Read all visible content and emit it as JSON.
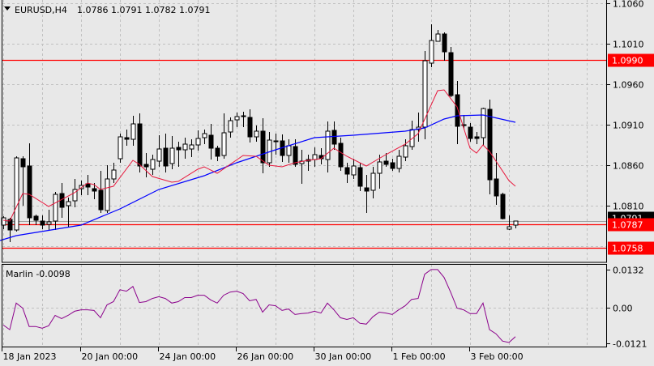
{
  "header": {
    "symbol": "EURUSD,H4",
    "ohlc": "1.0786 1.0791 1.0782 1.0791",
    "menu_icon": "triangle-down-icon"
  },
  "indicator": {
    "label": "Marlin -0.0098",
    "color": "#8b008b"
  },
  "price_tags": [
    {
      "text": "1.0990",
      "value": 1.099,
      "bg": "#ff0000",
      "line": true
    },
    {
      "text": "1.0791",
      "value": 1.0791,
      "bg": "#000000",
      "line": false
    },
    {
      "text": "1.0787",
      "value": 1.0787,
      "bg": "#ff0000",
      "line": true
    },
    {
      "text": "1.0758",
      "value": 1.0758,
      "bg": "#ff0000",
      "line": true
    }
  ],
  "colors": {
    "bull": "#ffffff",
    "bear": "#000000",
    "ma_fast": "#e8173c",
    "ma_slow": "#0000ff",
    "grid": "#c0c0c0",
    "level": "#ff0000",
    "bid": "#a0a0a0"
  },
  "chart_data": [
    {
      "type": "candlestick",
      "title": "EURUSD,H4",
      "ylim": [
        1.074,
        1.1064
      ],
      "yticks": [
        "1.1060",
        "1.1010",
        "1.0960",
        "1.0910",
        "1.0860",
        "1.0810"
      ],
      "xticks": [
        {
          "label": "18 Jan 2023",
          "bar": 0
        },
        {
          "label": "20 Jan 00:00",
          "bar": 12
        },
        {
          "label": "24 Jan 00:00",
          "bar": 24
        },
        {
          "label": "26 Jan 00:00",
          "bar": 36
        },
        {
          "label": "30 Jan 00:00",
          "bar": 48
        },
        {
          "label": "1 Feb 00:00",
          "bar": 60
        },
        {
          "label": "3 Feb 00:00",
          "bar": 72
        }
      ],
      "grid": true,
      "ohlc": [
        [
          1.0786,
          1.0797,
          1.0781,
          1.0795
        ],
        [
          1.0793,
          1.0795,
          1.0765,
          1.078
        ],
        [
          1.078,
          1.0871,
          1.0778,
          1.0869
        ],
        [
          1.0868,
          1.0871,
          1.081,
          1.0858
        ],
        [
          1.0859,
          1.0887,
          1.0786,
          1.0795
        ],
        [
          1.0797,
          1.0799,
          1.0786,
          1.0792
        ],
        [
          1.0791,
          1.0798,
          1.0781,
          1.0786
        ],
        [
          1.0787,
          1.0805,
          1.078,
          1.079
        ],
        [
          1.0791,
          1.0827,
          1.078,
          1.0824
        ],
        [
          1.0825,
          1.0838,
          1.0795,
          1.0808
        ],
        [
          1.081,
          1.082,
          1.0783,
          1.0815
        ],
        [
          1.0816,
          1.0843,
          1.0808,
          1.083
        ],
        [
          1.0831,
          1.0841,
          1.0823,
          1.0835
        ],
        [
          1.0837,
          1.0848,
          1.0823,
          1.0833
        ],
        [
          1.0831,
          1.0838,
          1.0818,
          1.0828
        ],
        [
          1.0829,
          1.0853,
          1.0801,
          1.0805
        ],
        [
          1.0804,
          1.086,
          1.0801,
          1.0843
        ],
        [
          1.0843,
          1.0863,
          1.0838,
          1.0854
        ],
        [
          1.0868,
          1.0899,
          1.0863,
          1.0895
        ],
        [
          1.0894,
          1.0904,
          1.0884,
          1.0892
        ],
        [
          1.0892,
          1.0921,
          1.0884,
          1.0911
        ],
        [
          1.0911,
          1.0924,
          1.0851,
          1.0859
        ],
        [
          1.0861,
          1.0875,
          1.0845,
          1.0858
        ],
        [
          1.0855,
          1.0873,
          1.0848,
          1.0867
        ],
        [
          1.0865,
          1.0897,
          1.0858,
          1.088
        ],
        [
          1.0881,
          1.0899,
          1.0851,
          1.0859
        ],
        [
          1.0862,
          1.0896,
          1.0855,
          1.0881
        ],
        [
          1.0882,
          1.0889,
          1.0858,
          1.0879
        ],
        [
          1.0879,
          1.0894,
          1.0868,
          1.0886
        ],
        [
          1.088,
          1.0892,
          1.087,
          1.0885
        ],
        [
          1.0885,
          1.0903,
          1.0878,
          1.0893
        ],
        [
          1.0894,
          1.0904,
          1.0886,
          1.0899
        ],
        [
          1.0897,
          1.0911,
          1.0867,
          1.0881
        ],
        [
          1.0881,
          1.0884,
          1.0865,
          1.0871
        ],
        [
          1.0872,
          1.0924,
          1.0868,
          1.09
        ],
        [
          1.0901,
          1.0919,
          1.0894,
          1.0915
        ],
        [
          1.0916,
          1.0925,
          1.0907,
          1.092
        ],
        [
          1.0921,
          1.0926,
          1.0907,
          1.092
        ],
        [
          1.0919,
          1.0929,
          1.0888,
          1.0895
        ],
        [
          1.0895,
          1.0909,
          1.0889,
          1.0902
        ],
        [
          1.0902,
          1.0918,
          1.085,
          1.0863
        ],
        [
          1.0863,
          1.0901,
          1.0858,
          1.0891
        ],
        [
          1.089,
          1.0899,
          1.0873,
          1.0889
        ],
        [
          1.089,
          1.0898,
          1.0864,
          1.0872
        ],
        [
          1.0872,
          1.0892,
          1.0863,
          1.0884
        ],
        [
          1.0883,
          1.0892,
          1.0858,
          1.0861
        ],
        [
          1.0862,
          1.0879,
          1.0837,
          1.0865
        ],
        [
          1.0865,
          1.0873,
          1.0853,
          1.0867
        ],
        [
          1.0867,
          1.0882,
          1.0858,
          1.0873
        ],
        [
          1.0872,
          1.0881,
          1.0861,
          1.0868
        ],
        [
          1.0867,
          1.0914,
          1.0851,
          1.0902
        ],
        [
          1.0903,
          1.0914,
          1.0879,
          1.0886
        ],
        [
          1.0887,
          1.0894,
          1.0853,
          1.0858
        ],
        [
          1.0857,
          1.0863,
          1.0838,
          1.0849
        ],
        [
          1.0848,
          1.0868,
          1.0843,
          1.0859
        ],
        [
          1.0857,
          1.0863,
          1.0828,
          1.0834
        ],
        [
          1.0832,
          1.0848,
          1.0801,
          1.0828
        ],
        [
          1.0829,
          1.0858,
          1.0819,
          1.085
        ],
        [
          1.085,
          1.0873,
          1.0831,
          1.0864
        ],
        [
          1.0865,
          1.0875,
          1.0858,
          1.0861
        ],
        [
          1.0863,
          1.0868,
          1.0853,
          1.0856
        ],
        [
          1.0856,
          1.0879,
          1.0851,
          1.0871
        ],
        [
          1.087,
          1.0892,
          1.0865,
          1.0884
        ],
        [
          1.0883,
          1.0915,
          1.0879,
          1.0904
        ],
        [
          1.0904,
          1.0925,
          1.0889,
          1.0907
        ],
        [
          1.0907,
          1.1001,
          1.0892,
          1.0989
        ],
        [
          1.0986,
          1.1034,
          1.0981,
          1.1014
        ],
        [
          1.1013,
          1.1027,
          1.1013,
          1.1022
        ],
        [
          1.1022,
          1.1024,
          1.0989,
          1.1
        ],
        [
          1.0999,
          1.1006,
          1.0944,
          1.0946
        ],
        [
          1.0947,
          1.0964,
          1.0886,
          1.0908
        ],
        [
          1.091,
          1.0922,
          1.0904,
          1.0909
        ],
        [
          1.0907,
          1.0912,
          1.0889,
          1.0893
        ],
        [
          1.0895,
          1.0901,
          1.0886,
          1.0893
        ],
        [
          1.0894,
          1.0931,
          1.0884,
          1.093
        ],
        [
          1.0929,
          1.0941,
          1.0824,
          1.0842
        ],
        [
          1.0843,
          1.0875,
          1.0811,
          1.0822
        ],
        [
          1.0824,
          1.0826,
          1.0793,
          1.0794
        ],
        [
          1.0781,
          1.0798,
          1.078,
          1.0784
        ],
        [
          1.0786,
          1.0791,
          1.0782,
          1.0791
        ]
      ],
      "ma_fast": [
        [
          0,
          1.0792
        ],
        [
          1,
          1.0791
        ],
        [
          3,
          1.0825
        ],
        [
          4,
          1.0824
        ],
        [
          7,
          1.0809
        ],
        [
          11,
          1.0826
        ],
        [
          13,
          1.0838
        ],
        [
          14,
          1.0836
        ],
        [
          15,
          1.083
        ],
        [
          17,
          1.0834
        ],
        [
          20,
          1.0866
        ],
        [
          21,
          1.0861
        ],
        [
          23,
          1.0846
        ],
        [
          26,
          1.0839
        ],
        [
          27,
          1.084
        ],
        [
          30,
          1.0855
        ],
        [
          31,
          1.0858
        ],
        [
          33,
          1.085
        ],
        [
          37,
          1.0872
        ],
        [
          39,
          1.0871
        ],
        [
          41,
          1.086
        ],
        [
          43,
          1.0858
        ],
        [
          45,
          1.0863
        ],
        [
          47,
          1.0866
        ],
        [
          49,
          1.0868
        ],
        [
          51,
          1.0881
        ],
        [
          53,
          1.0871
        ],
        [
          56,
          1.0859
        ],
        [
          59,
          1.0873
        ],
        [
          62,
          1.0886
        ],
        [
          64,
          1.0899
        ],
        [
          67,
          1.0952
        ],
        [
          68,
          1.0953
        ],
        [
          70,
          1.0932
        ],
        [
          72,
          1.0881
        ],
        [
          73,
          1.0875
        ],
        [
          74,
          1.0885
        ],
        [
          75,
          1.0877
        ],
        [
          78,
          1.0841
        ],
        [
          79,
          1.0834
        ]
      ],
      "ma_slow": [
        [
          -0.5,
          1.0767
        ],
        [
          2,
          1.0773
        ],
        [
          12,
          1.0786
        ],
        [
          18,
          1.0806
        ],
        [
          24,
          1.083
        ],
        [
          31,
          1.0847
        ],
        [
          36,
          1.0863
        ],
        [
          42,
          1.0879
        ],
        [
          48,
          1.0894
        ],
        [
          54,
          1.0897
        ],
        [
          62,
          1.0902
        ],
        [
          65,
          1.0906
        ],
        [
          68,
          1.0917
        ],
        [
          70,
          1.0921
        ],
        [
          74,
          1.0922
        ],
        [
          79,
          1.0913
        ]
      ]
    },
    {
      "type": "line",
      "title": "Marlin",
      "ylim": [
        -0.0132,
        0.01485
      ],
      "yticks": [
        {
          "label": "0.0132",
          "value": 0.0132
        },
        {
          "label": "0.00",
          "value": 0
        },
        {
          "label": "-0.0121",
          "value": -0.0121
        }
      ],
      "values": [
        -0.0058,
        -0.0074,
        0.0017,
        0,
        -0.0063,
        -0.0063,
        -0.0069,
        -0.0061,
        -0.0025,
        -0.0036,
        -0.0025,
        -0.0011,
        -0.0006,
        -0.0006,
        -0.0008,
        -0.0033,
        0.0011,
        0.0022,
        0.0063,
        0.0058,
        0.0074,
        0.0019,
        0.0022,
        0.0033,
        0.0039,
        0.0033,
        0.0017,
        0.0022,
        0.0036,
        0.0036,
        0.0044,
        0.0044,
        0.0028,
        0.0017,
        0.0044,
        0.0055,
        0.0058,
        0.005,
        0.0025,
        0.003,
        -0.0014,
        0.0011,
        0.0008,
        -0.0008,
        -0.0003,
        -0.0022,
        -0.0019,
        -0.0017,
        -0.0011,
        -0.0017,
        0.0017,
        -0.0006,
        -0.0033,
        -0.0039,
        -0.0033,
        -0.0052,
        -0.0055,
        -0.003,
        -0.0014,
        -0.0017,
        -0.0022,
        -0.0006,
        0.0008,
        0.003,
        0.0033,
        0.0116,
        0.0132,
        0.0132,
        0.0105,
        0.0055,
        0,
        -0.0006,
        -0.0019,
        -0.0019,
        0.0017,
        -0.0074,
        -0.0088,
        -0.0113,
        -0.0118,
        -0.0098
      ]
    }
  ]
}
